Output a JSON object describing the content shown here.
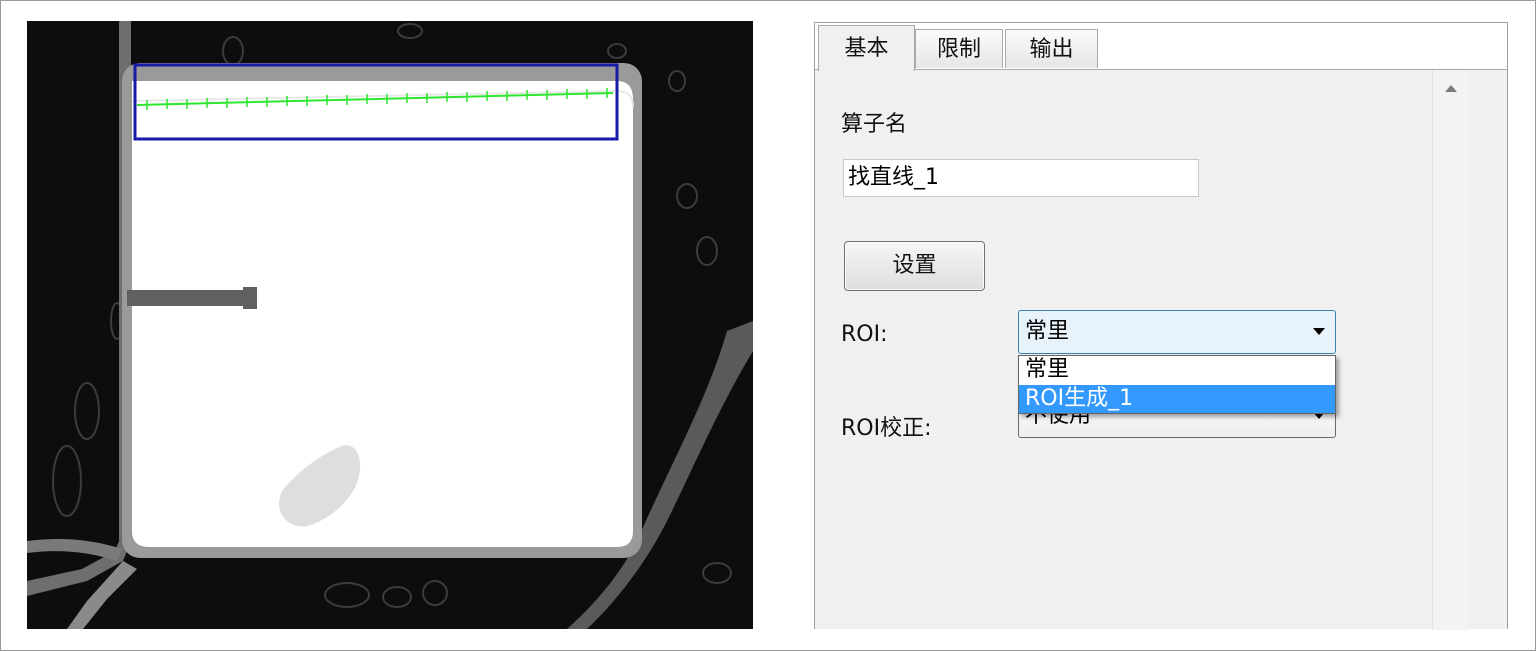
{
  "tabs": [
    {
      "label": "基本",
      "active": true
    },
    {
      "label": "限制",
      "active": false
    },
    {
      "label": "输出",
      "active": false
    }
  ],
  "form": {
    "name_label": "算子名",
    "name_value": "找直线_1",
    "settings_button": "设置",
    "roi_label": "ROI:",
    "roi_value": "常里",
    "roi_options": [
      "常里",
      "ROI生成_1"
    ],
    "roi_highlighted_option": "ROI生成_1",
    "roi_correction_label": "ROI校正:",
    "roi_correction_value": "不使用"
  },
  "colors": {
    "roi_box": "#1a1aa8",
    "edge_points": "#2ee62e",
    "selection": "#3399ff"
  },
  "icons": {
    "scroll_up": "triangle-up-icon",
    "combo_arrow": "triangle-down-icon"
  }
}
